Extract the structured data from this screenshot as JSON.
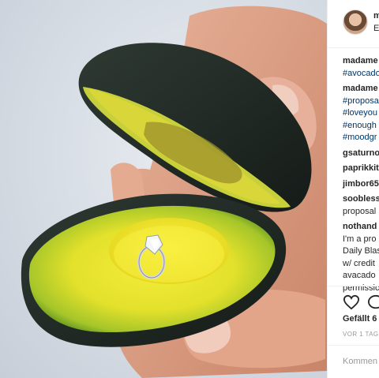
{
  "post": {
    "photo_alt": "avocado-ring-box-photo",
    "header": {
      "username": "m",
      "subtitle": "E"
    },
    "comments": [
      {
        "user": "madame",
        "lines": [
          {
            "text": "#avocado",
            "tag": true
          }
        ]
      },
      {
        "user": "madame",
        "lines": [
          {
            "text": "#proposa",
            "tag": true
          },
          {
            "text": "#loveyou",
            "tag": true
          },
          {
            "text": "#enough",
            "tag": true
          },
          {
            "text": "#moodgr",
            "tag": true
          }
        ]
      },
      {
        "user": "gsaturno",
        "lines": []
      },
      {
        "user": "paprikkit",
        "lines": []
      },
      {
        "user": "jimbor65",
        "lines": []
      },
      {
        "user": "soobless",
        "lines": [
          {
            "text": "proposal",
            "tag": false
          }
        ]
      },
      {
        "user": "nothand",
        "lines": [
          {
            "text": "I'm a pro",
            "tag": false
          },
          {
            "text": "Daily Blas",
            "tag": false
          },
          {
            "text": "w/ credit",
            "tag": false
          },
          {
            "text": "avacado",
            "tag": false
          },
          {
            "text": "permissic",
            "tag": false
          }
        ]
      }
    ],
    "likes_text": "Gefällt 6",
    "time_text": "VOR 1 TAG",
    "add_comment_placeholder": "Kommen"
  }
}
